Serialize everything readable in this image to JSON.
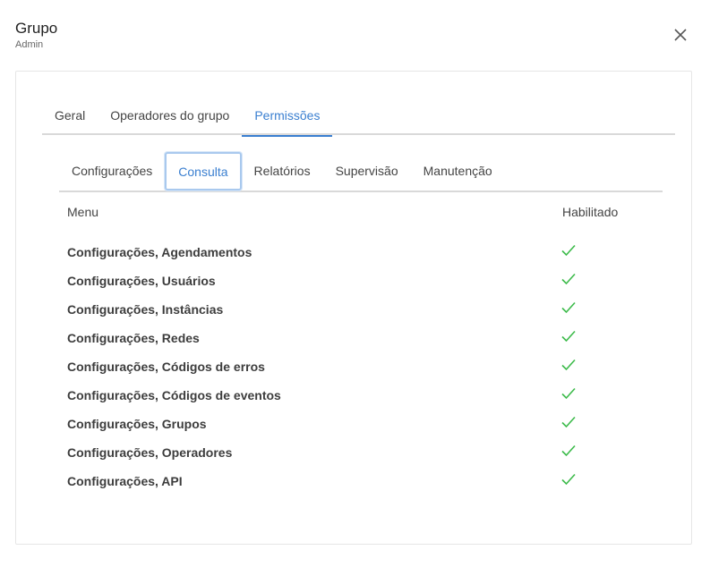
{
  "header": {
    "title": "Grupo",
    "subtitle": "Admin",
    "close_icon": "close-icon"
  },
  "main_tabs": [
    {
      "label": "Geral",
      "active": false
    },
    {
      "label": "Operadores do grupo",
      "active": false
    },
    {
      "label": "Permissões",
      "active": true
    }
  ],
  "sub_tabs": [
    {
      "label": "Configurações",
      "active": false
    },
    {
      "label": "Consulta",
      "active": true
    },
    {
      "label": "Relatórios",
      "active": false
    },
    {
      "label": "Supervisão",
      "active": false
    },
    {
      "label": "Manutenção",
      "active": false
    }
  ],
  "table": {
    "columns": {
      "menu": "Menu",
      "enabled": "Habilitado"
    },
    "rows": [
      {
        "menu": "Configurações, Agendamentos",
        "enabled": true
      },
      {
        "menu": "Configurações, Usuários",
        "enabled": true
      },
      {
        "menu": "Configurações, Instâncias",
        "enabled": true
      },
      {
        "menu": "Configurações, Redes",
        "enabled": true
      },
      {
        "menu": "Configurações, Códigos de erros",
        "enabled": true
      },
      {
        "menu": "Configurações, Códigos de eventos",
        "enabled": true
      },
      {
        "menu": "Configurações, Grupos",
        "enabled": true
      },
      {
        "menu": "Configurações, Operadores",
        "enabled": true
      },
      {
        "menu": "Configurações, API",
        "enabled": true
      }
    ]
  },
  "colors": {
    "accent": "#3a7fd0",
    "check": "#3dbb4b"
  }
}
